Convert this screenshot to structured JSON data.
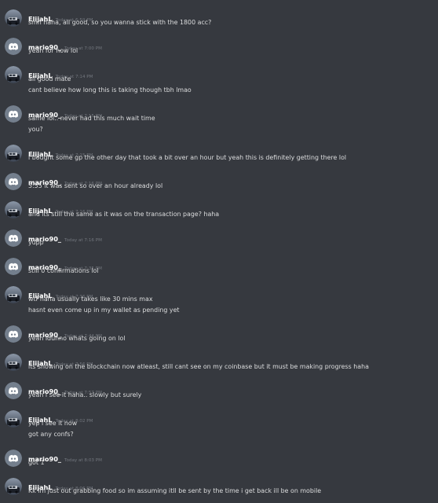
{
  "colors": {
    "background": "#36393f",
    "author": "#ffffff",
    "text": "#dcddde",
    "timestamp": "#72767d",
    "discord_avatar": "#747f8d"
  },
  "messages": [
    {
      "author": "ElijahL",
      "avatar": "user-photo-icon",
      "time": "Today at 6:59 PM",
      "lines": [
        "smh haha, all good, so you wanna stick with the 1800 acc?"
      ]
    },
    {
      "author": "mario90_",
      "avatar": "discord-default-avatar-icon",
      "time": "Today at 7:00 PM",
      "lines": [
        "yeah for now lol"
      ]
    },
    {
      "author": "ElijahL",
      "avatar": "user-photo-icon",
      "time": "Today at 7:14 PM",
      "lines": [
        "all good mate",
        "cant believe how long this is taking though tbh lmao"
      ]
    },
    {
      "author": "mario90_",
      "avatar": "discord-default-avatar-icon",
      "time": "Today at 7:15 PM",
      "lines": [
        "same lol.. never had this much wait time",
        "you?"
      ]
    },
    {
      "author": "ElijahL",
      "avatar": "user-photo-icon",
      "time": "Today at 7:15 PM",
      "lines": [
        "i bought some gp the other day that took a bit over an hour but yeah this is definitely getting there lol"
      ]
    },
    {
      "author": "mario90_",
      "avatar": "discord-default-avatar-icon",
      "time": "Today at 7:16 PM",
      "lines": [
        "5:55 it was sent so over an hour already lol"
      ]
    },
    {
      "author": "ElijahL",
      "avatar": "user-photo-icon",
      "time": "Today at 7:16 PM",
      "lines": [
        "and its still the same as it was on the transaction page? haha"
      ]
    },
    {
      "author": "mario90_",
      "avatar": "discord-default-avatar-icon",
      "time": "Today at 7:16 PM",
      "lines": [
        "yupp"
      ]
    },
    {
      "author": "mario90_",
      "avatar": "discord-default-avatar-icon",
      "time": "Today at 7:35 PM",
      "lines": [
        "still 0 confirmations lol"
      ]
    },
    {
      "author": "ElijahL",
      "avatar": "user-photo-icon",
      "time": "Today at 7:36 PM",
      "lines": [
        "wtf haha usually takes like 30 mins max",
        "hasnt even come up in my wallet as pending yet"
      ]
    },
    {
      "author": "mario90_",
      "avatar": "discord-default-avatar-icon",
      "time": "Today at 7:44 PM",
      "lines": [
        "yeah idunno whats going on lol"
      ]
    },
    {
      "author": "ElijahL",
      "avatar": "user-photo-icon",
      "time": "Today at 7:56 PM",
      "lines": [
        "its showing on the blockchain now atleast, still cant see on my coinbase but it must be making progress haha"
      ]
    },
    {
      "author": "mario90_",
      "avatar": "discord-default-avatar-icon",
      "time": "Today at 7:57 PM",
      "lines": [
        "yeah i see it haha.. slowly but surely"
      ]
    },
    {
      "author": "ElijahL",
      "avatar": "user-photo-icon",
      "time": "Today at 8:02 PM",
      "lines": [
        "yep i see it now",
        "got any confs?"
      ]
    },
    {
      "author": "mario90_",
      "avatar": "discord-default-avatar-icon",
      "time": "Today at 8:03 PM",
      "lines": [
        "got 1"
      ]
    },
    {
      "author": "ElijahL",
      "avatar": "user-photo-icon",
      "time": "Today at 8:06 PM",
      "lines": [
        "Kk im just out grabbing food so im assuming itll be sent by the time i get back ill be on mobile"
      ]
    }
  ]
}
